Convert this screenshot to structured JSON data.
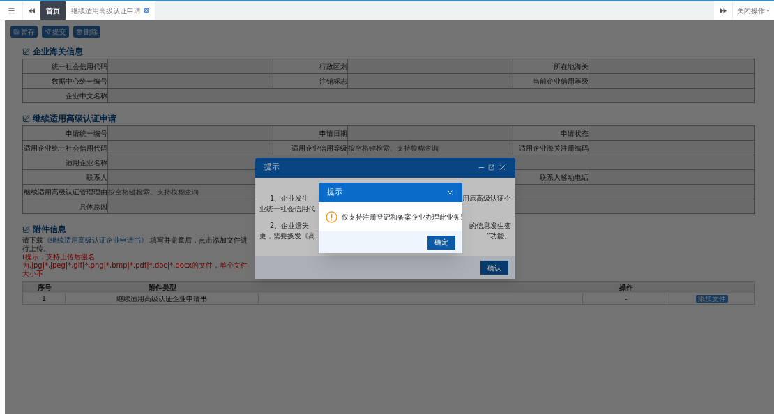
{
  "top_bar": {
    "tabs": [
      {
        "label": "首页",
        "selected": true,
        "closable": false
      },
      {
        "label": "继续适用高级认证申请",
        "selected": false,
        "closable": true
      }
    ],
    "close_menu": "关闭操作"
  },
  "toolbar": [
    {
      "kind": "save",
      "label": "暂存"
    },
    {
      "kind": "submit",
      "label": "提交"
    },
    {
      "kind": "delete",
      "label": "删除"
    }
  ],
  "sections": [
    {
      "title": "企业海关信息",
      "rows": [
        [
          {
            "label": "统一社会信用代码"
          },
          {
            "label": "行政区划"
          },
          {
            "label": "所在地海关"
          }
        ],
        [
          {
            "label": "数据中心统一编号"
          },
          {
            "label": "注销标志"
          },
          {
            "label": "当前企业信用等级"
          }
        ],
        [
          {
            "label": "企业中文名称",
            "wide": true
          }
        ]
      ]
    },
    {
      "title": "继续适用高级认证申请",
      "rows": [
        [
          {
            "label": "申请统一编号"
          },
          {
            "label": "申请日期"
          },
          {
            "label": "申请状态"
          }
        ],
        [
          {
            "label": "适用企业统一社会信用代码"
          },
          {
            "label": "适用企业信用等级",
            "placeholder": "按空格键检索、支持模糊查询"
          },
          {
            "label": "适用企业海关注册编码"
          }
        ],
        [
          {
            "label": "适用企业名称",
            "wide": true
          }
        ],
        [
          {
            "label": "联系人"
          },
          {},
          {
            "label": "联系人移动电话"
          }
        ],
        [
          {
            "label": "继续适用高级认证管理理由",
            "placeholder": "按空格键检索、支持模糊查询",
            "wide": true
          }
        ],
        [
          {
            "label": "具体原因",
            "wide": true
          }
        ]
      ]
    }
  ],
  "attachments": {
    "title": "附件信息",
    "instruction_before": "请下载",
    "link": "《继续适用高级认证企业申请书》",
    "instruction_after": ",填写并盖章后，点击添加文件进行上传。",
    "hint": "(提示：支持上传后缀名为.jpg|*.jpeg|*.gif|*.png|*.bmp|*.pdf|*.doc|*.docx的文件，单个文件大小不",
    "columns": [
      "序号",
      "附件类型",
      "操作"
    ],
    "rows": [
      {
        "index": "1",
        "type": "继续适用高级认证企业申请书",
        "status": "-",
        "action": "添加文件"
      }
    ]
  },
  "dialog": {
    "title": "提示",
    "lines": [
      {
        "left": "1、企业发生",
        "right": "用原高级认证企",
        "indent": true
      },
      {
        "left": "业统一社会信用代",
        "indent": false
      },
      {
        "left": "2、企业遗失",
        "right": "的信息发生变",
        "indent": true
      },
      {
        "left": "更，需要换发《高",
        "right": "”功能。",
        "indent": false
      }
    ],
    "button": "确认"
  },
  "alert": {
    "title": "提示",
    "message": "仅支持注册登记和备案企业办理此业务!",
    "button": "确定"
  }
}
